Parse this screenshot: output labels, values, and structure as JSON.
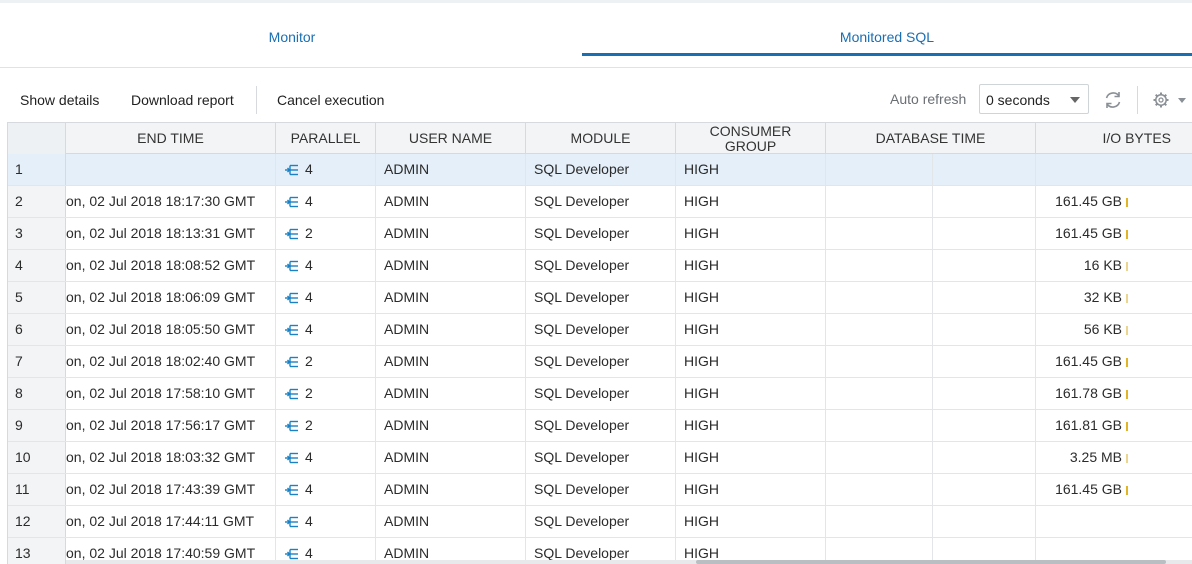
{
  "tabs": [
    {
      "label": "Monitor",
      "active": false
    },
    {
      "label": "Monitored SQL",
      "active": true
    }
  ],
  "toolbar": {
    "show_details": "Show details",
    "download_report": "Download report",
    "cancel_execution": "Cancel execution",
    "auto_refresh_label": "Auto refresh",
    "auto_refresh_value": "0 seconds",
    "refresh_icon": "refresh-icon",
    "settings_icon": "gear-icon"
  },
  "colors": {
    "accent": "#1a6fb3",
    "selected_row": "#e4eff9",
    "io_bar": "#e2b428"
  },
  "table": {
    "columns": [
      "END TIME",
      "PARALLEL",
      "USER NAME",
      "MODULE",
      "CONSUMER GROUP",
      "DATABASE TIME",
      "I/O BYTES"
    ],
    "rows": [
      {
        "num": "1",
        "end_time": "",
        "parallel": "4",
        "user": "ADMIN",
        "module": "SQL Developer",
        "consumer": "HIGH",
        "io_bytes": "",
        "io_bar": false,
        "selected": true
      },
      {
        "num": "2",
        "end_time": "on, 02 Jul 2018 18:17:30 GMT",
        "parallel": "4",
        "user": "ADMIN",
        "module": "SQL Developer",
        "consumer": "HIGH",
        "io_bytes": "161.45 GB",
        "io_bar": true
      },
      {
        "num": "3",
        "end_time": "on, 02 Jul 2018 18:13:31 GMT",
        "parallel": "2",
        "user": "ADMIN",
        "module": "SQL Developer",
        "consumer": "HIGH",
        "io_bytes": "161.45 GB",
        "io_bar": true
      },
      {
        "num": "4",
        "end_time": "on, 02 Jul 2018 18:08:52 GMT",
        "parallel": "4",
        "user": "ADMIN",
        "module": "SQL Developer",
        "consumer": "HIGH",
        "io_bytes": "16 KB",
        "io_bar": true
      },
      {
        "num": "5",
        "end_time": "on, 02 Jul 2018 18:06:09 GMT",
        "parallel": "4",
        "user": "ADMIN",
        "module": "SQL Developer",
        "consumer": "HIGH",
        "io_bytes": "32 KB",
        "io_bar": true
      },
      {
        "num": "6",
        "end_time": "on, 02 Jul 2018 18:05:50 GMT",
        "parallel": "4",
        "user": "ADMIN",
        "module": "SQL Developer",
        "consumer": "HIGH",
        "io_bytes": "56 KB",
        "io_bar": true
      },
      {
        "num": "7",
        "end_time": "on, 02 Jul 2018 18:02:40 GMT",
        "parallel": "2",
        "user": "ADMIN",
        "module": "SQL Developer",
        "consumer": "HIGH",
        "io_bytes": "161.45 GB",
        "io_bar": true
      },
      {
        "num": "8",
        "end_time": "on, 02 Jul 2018 17:58:10 GMT",
        "parallel": "2",
        "user": "ADMIN",
        "module": "SQL Developer",
        "consumer": "HIGH",
        "io_bytes": "161.78 GB",
        "io_bar": true
      },
      {
        "num": "9",
        "end_time": "on, 02 Jul 2018 17:56:17 GMT",
        "parallel": "2",
        "user": "ADMIN",
        "module": "SQL Developer",
        "consumer": "HIGH",
        "io_bytes": "161.81 GB",
        "io_bar": true
      },
      {
        "num": "10",
        "end_time": "on, 02 Jul 2018 18:03:32 GMT",
        "parallel": "4",
        "user": "ADMIN",
        "module": "SQL Developer",
        "consumer": "HIGH",
        "io_bytes": "3.25 MB",
        "io_bar": true
      },
      {
        "num": "11",
        "end_time": "on, 02 Jul 2018 17:43:39 GMT",
        "parallel": "4",
        "user": "ADMIN",
        "module": "SQL Developer",
        "consumer": "HIGH",
        "io_bytes": "161.45 GB",
        "io_bar": true
      },
      {
        "num": "12",
        "end_time": "on, 02 Jul 2018 17:44:11 GMT",
        "parallel": "4",
        "user": "ADMIN",
        "module": "SQL Developer",
        "consumer": "HIGH",
        "io_bytes": "",
        "io_bar": false
      },
      {
        "num": "13",
        "end_time": "on, 02 Jul 2018 17:40:59 GMT",
        "parallel": "4",
        "user": "ADMIN",
        "module": "SQL Developer",
        "consumer": "HIGH",
        "io_bytes": "",
        "io_bar": false
      }
    ]
  }
}
